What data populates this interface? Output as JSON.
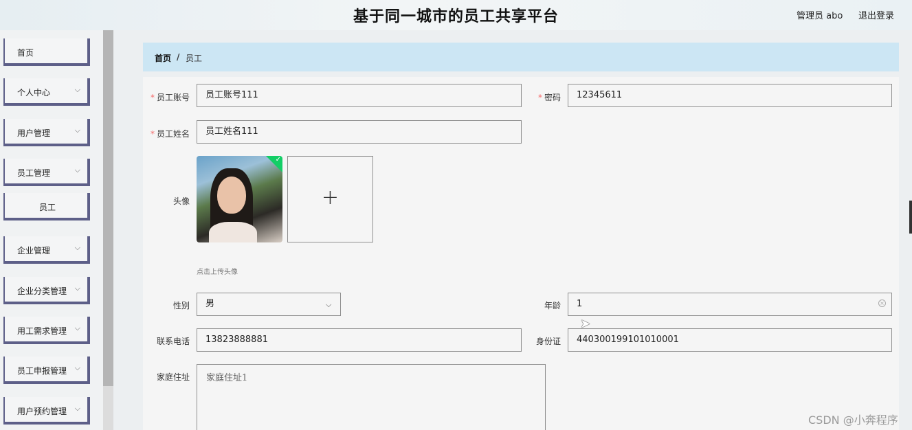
{
  "header": {
    "title": "基于同一城市的员工共享平台",
    "user_label": "管理员 abo",
    "logout_label": "退出登录"
  },
  "sidebar": {
    "items": [
      {
        "label": "首页",
        "has_chevron": false
      },
      {
        "label": "个人中心",
        "has_chevron": true
      },
      {
        "label": "用户管理",
        "has_chevron": true
      },
      {
        "label": "员工管理",
        "has_chevron": true
      },
      {
        "label": "员工",
        "has_chevron": false,
        "sub": true
      },
      {
        "label": "企业管理",
        "has_chevron": true
      },
      {
        "label": "企业分类管理",
        "has_chevron": true
      },
      {
        "label": "用工需求管理",
        "has_chevron": true
      },
      {
        "label": "员工申报管理",
        "has_chevron": true
      },
      {
        "label": "用户预约管理",
        "has_chevron": true
      }
    ]
  },
  "breadcrumb": {
    "home": "首页",
    "separator": "/",
    "current": "员工"
  },
  "form": {
    "account_label": "员工账号",
    "account_value": "员工账号111",
    "password_label": "密码",
    "password_value": "12345611",
    "name_label": "员工姓名",
    "name_value": "员工姓名111",
    "avatar_label": "头像",
    "upload_plus": "+",
    "upload_hint": "点击上传头像",
    "gender_label": "性别",
    "gender_value": "男",
    "age_label": "年龄",
    "age_value": "1",
    "phone_label": "联系电话",
    "phone_value": "13823888881",
    "id_label": "身份证",
    "id_value": "440300199101010001",
    "address_label": "家庭住址",
    "address_value": "家庭住址1",
    "required_mark": "*"
  },
  "watermark": "CSDN @小奔程序",
  "colors": {
    "breadcrumb_bg": "#cce6f4",
    "menu_border": "#5d5f88",
    "required": "#f56c6c",
    "upload_success": "#13ce66"
  }
}
